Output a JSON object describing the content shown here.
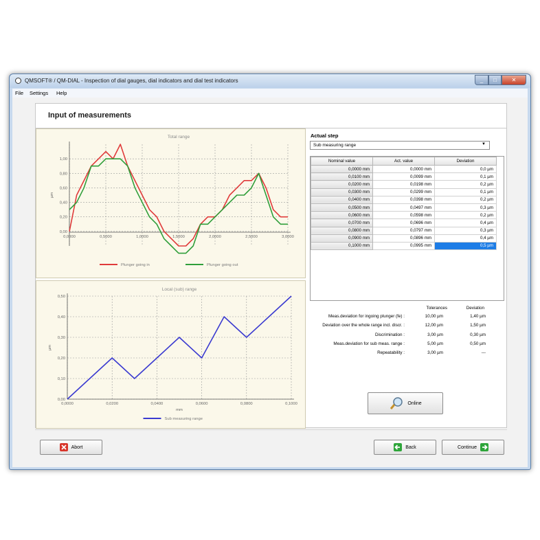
{
  "window": {
    "title": "QMSOFT® / QM-DIAL - Inspection of dial gauges, dial indicators and dial test indicators"
  },
  "menu": [
    "File",
    "Settings",
    "Help"
  ],
  "page_title": "Input of measurements",
  "actual_step": {
    "label": "Actual step",
    "selected": "Sub measuring range",
    "table": {
      "headers": [
        "Nominal value",
        "Act. value",
        "Deviation"
      ],
      "rows": [
        [
          "0,0000 mm",
          "0,0000 mm",
          "0,0 µm"
        ],
        [
          "0,0100 mm",
          "0,0099 mm",
          "0,1 µm"
        ],
        [
          "0,0200 mm",
          "0,0198 mm",
          "0,2 µm"
        ],
        [
          "0,0300 mm",
          "0,0299 mm",
          "0,1 µm"
        ],
        [
          "0,0400 mm",
          "0,0398 mm",
          "0,2 µm"
        ],
        [
          "0,0500 mm",
          "0,0497 mm",
          "0,3 µm"
        ],
        [
          "0,0600 mm",
          "0,0598 mm",
          "0,2 µm"
        ],
        [
          "0,0700 mm",
          "0,0696 mm",
          "0,4 µm"
        ],
        [
          "0,0800 mm",
          "0,0797 mm",
          "0,3 µm"
        ],
        [
          "0,0900 mm",
          "0,0896 mm",
          "0,4 µm"
        ],
        [
          "0,1000 mm",
          "0,0995 mm",
          "0,5 µm"
        ]
      ]
    }
  },
  "stats": {
    "headers": {
      "tolerances": "Tolerances",
      "deviation": "Deviation"
    },
    "rows": [
      {
        "label": "Meas.deviation for ingoing plunger (fe) :",
        "tol": "10,00 µm",
        "dev": "1,40 µm"
      },
      {
        "label": "Deviation over the whole range incl. discr. :",
        "tol": "12,00 µm",
        "dev": "1,50 µm"
      },
      {
        "label": "Discrimination :",
        "tol": "3,00 µm",
        "dev": "0,30 µm"
      },
      {
        "label": "Meas.deviation for sub meas. range :",
        "tol": "5,00 µm",
        "dev": "0,50 µm"
      },
      {
        "label": "Repeatability :",
        "tol": "3,00 µm",
        "dev": "---"
      }
    ]
  },
  "buttons": {
    "online": "Online",
    "abort": "Abort",
    "back": "Back",
    "continue": "Continue"
  },
  "colors": {
    "red": "#e03a3a",
    "green": "#2f9e3a",
    "blue": "#3a3ad0",
    "selected": "#1e7de6"
  },
  "chart_data": [
    {
      "type": "line",
      "title": "Total range",
      "ylabel": "µm",
      "xlim": [
        0,
        3.0
      ],
      "ylim": [
        -0.2,
        1.2
      ],
      "xticks": [
        "0,0000",
        "0,5000",
        "1,0000",
        "1,5000",
        "2,0000",
        "2,5000",
        "3,0000"
      ],
      "yticks": [
        "0,00",
        "0,20",
        "0,40",
        "0,60",
        "0,80",
        "1,00"
      ],
      "legend_position": "bottom",
      "series": [
        {
          "name": "Plunger going in",
          "color": "#e03a3a",
          "x": [
            0,
            0.1,
            0.2,
            0.3,
            0.4,
            0.5,
            0.6,
            0.7,
            0.8,
            0.9,
            1.0,
            1.1,
            1.2,
            1.3,
            1.4,
            1.5,
            1.6,
            1.7,
            1.8,
            1.9,
            2.0,
            2.1,
            2.2,
            2.3,
            2.4,
            2.5,
            2.6,
            2.7,
            2.8,
            2.9,
            3.0
          ],
          "y": [
            0,
            0.5,
            0.7,
            0.9,
            1.0,
            1.1,
            1.0,
            1.2,
            0.9,
            0.7,
            0.5,
            0.3,
            0.2,
            0.0,
            -0.1,
            -0.2,
            -0.2,
            -0.1,
            0.1,
            0.2,
            0.2,
            0.3,
            0.5,
            0.6,
            0.7,
            0.7,
            0.8,
            0.6,
            0.3,
            0.2,
            0.2
          ]
        },
        {
          "name": "Plunger going out",
          "color": "#2f9e3a",
          "x": [
            0,
            0.1,
            0.2,
            0.3,
            0.4,
            0.5,
            0.6,
            0.7,
            0.8,
            0.9,
            1.0,
            1.1,
            1.2,
            1.3,
            1.4,
            1.5,
            1.6,
            1.7,
            1.8,
            1.9,
            2.0,
            2.1,
            2.2,
            2.3,
            2.4,
            2.5,
            2.6,
            2.7,
            2.8,
            2.9,
            3.0
          ],
          "y": [
            0.3,
            0.4,
            0.6,
            0.9,
            0.9,
            1.0,
            1.0,
            1.0,
            0.9,
            0.6,
            0.4,
            0.2,
            0.1,
            -0.1,
            -0.2,
            -0.3,
            -0.3,
            -0.2,
            0.1,
            0.1,
            0.2,
            0.3,
            0.4,
            0.5,
            0.5,
            0.6,
            0.8,
            0.5,
            0.2,
            0.1,
            0.1
          ]
        }
      ]
    },
    {
      "type": "line",
      "title": "Local (sub) range",
      "xlabel": "mm",
      "ylabel": "µm",
      "xlim": [
        0,
        0.1
      ],
      "ylim": [
        0,
        0.5
      ],
      "xticks": [
        "0,0000",
        "0,0200",
        "0,0400",
        "0,0600",
        "0,0800",
        "0,1000"
      ],
      "yticks": [
        "0,00",
        "0,10",
        "0,20",
        "0,30",
        "0,40",
        "0,50"
      ],
      "legend_position": "bottom",
      "series": [
        {
          "name": "Sub measuring range",
          "color": "#3a3ad0",
          "x": [
            0,
            0.01,
            0.02,
            0.03,
            0.04,
            0.05,
            0.06,
            0.07,
            0.08,
            0.09,
            0.1
          ],
          "y": [
            0,
            0.1,
            0.2,
            0.1,
            0.2,
            0.3,
            0.2,
            0.4,
            0.3,
            0.4,
            0.5
          ]
        }
      ]
    }
  ]
}
